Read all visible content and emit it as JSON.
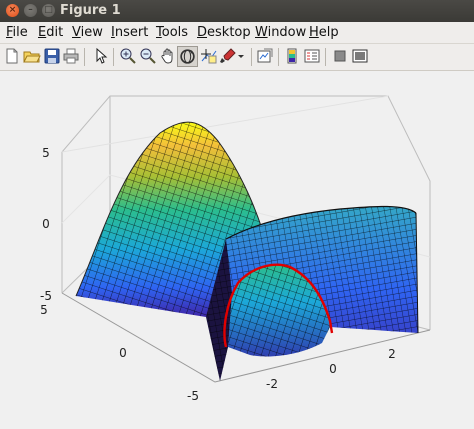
{
  "window": {
    "title": "Figure 1"
  },
  "menu": [
    {
      "label": "File",
      "mnemonic": "F"
    },
    {
      "label": "Edit",
      "mnemonic": "E"
    },
    {
      "label": "View",
      "mnemonic": "V"
    },
    {
      "label": "Insert",
      "mnemonic": "I"
    },
    {
      "label": "Tools",
      "mnemonic": "T"
    },
    {
      "label": "Desktop",
      "mnemonic": "D"
    },
    {
      "label": "Window",
      "mnemonic": "W"
    },
    {
      "label": "Help",
      "mnemonic": "H"
    }
  ],
  "toolbar": {
    "buttons": [
      "new-figure-icon",
      "open-file-icon",
      "save-icon",
      "print-icon",
      "edit-plot-arrow-icon",
      "zoom-in-icon",
      "zoom-out-icon",
      "rotate-3d-icon",
      "data-cursor-icon",
      "brush-icon",
      "brush-dropdown-icon",
      "link-plot-icon",
      "insert-colorbar-icon",
      "insert-legend-icon",
      "hide-plot-tools-icon",
      "show-plot-tools-icon"
    ],
    "active": "rotate-3d-icon"
  },
  "axes": {
    "z_ticks": [
      "5",
      "0",
      "-5"
    ],
    "y_ticks": [
      "5",
      "0",
      "-5"
    ],
    "x_ticks": [
      "-2",
      "0",
      "2"
    ],
    "colormap": [
      "#3e26a8",
      "#2f64f2",
      "#1ca8d8",
      "#2bbd8e",
      "#a7bf35",
      "#f3bf3a",
      "#f9fb15"
    ],
    "curve_color": "#e00000",
    "view": "3d"
  }
}
